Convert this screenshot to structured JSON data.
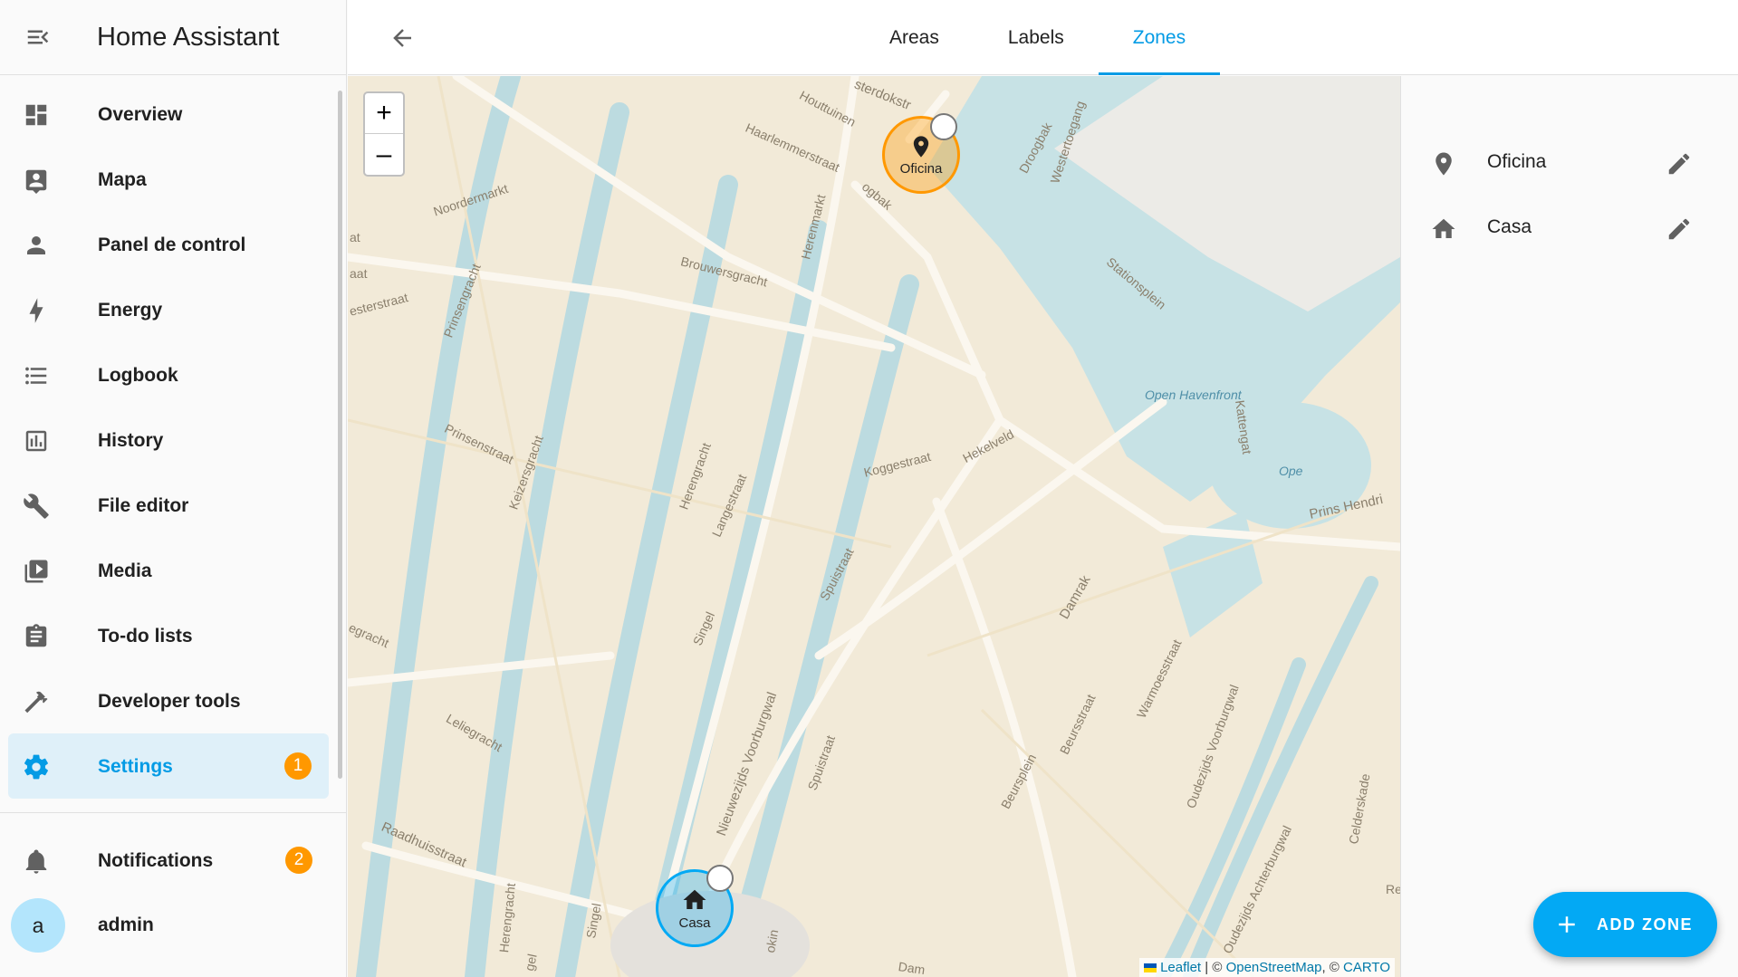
{
  "app": {
    "title": "Home Assistant"
  },
  "sidebar": {
    "items": [
      {
        "label": "Overview",
        "icon": "dashboard-icon"
      },
      {
        "label": "Mapa",
        "icon": "account-box-icon"
      },
      {
        "label": "Panel de control",
        "icon": "account-icon"
      },
      {
        "label": "Energy",
        "icon": "lightning-bolt-icon"
      },
      {
        "label": "Logbook",
        "icon": "format-list-icon"
      },
      {
        "label": "History",
        "icon": "chart-box-icon"
      },
      {
        "label": "File editor",
        "icon": "wrench-icon"
      },
      {
        "label": "Media",
        "icon": "play-box-multiple-icon"
      },
      {
        "label": "To-do lists",
        "icon": "clipboard-list-icon"
      },
      {
        "label": "Developer tools",
        "icon": "hammer-icon"
      },
      {
        "label": "Settings",
        "icon": "cog-icon",
        "badge": "1",
        "active": true
      }
    ],
    "notifications": {
      "label": "Notifications",
      "badge": "2"
    },
    "user": {
      "initial": "a",
      "name": "admin"
    }
  },
  "topbar": {
    "tabs": [
      {
        "label": "Areas"
      },
      {
        "label": "Labels"
      },
      {
        "label": "Zones",
        "active": true
      }
    ]
  },
  "map": {
    "zoom_in": "+",
    "zoom_out": "–",
    "street_labels": [
      "Houttuinen",
      "Haarlemmerstraat",
      "Noordermarkt",
      "Herenmarkt",
      "Brouwersgracht",
      "Droogbak",
      "Westertoegang",
      "Stationsplein",
      "Prinsengracht",
      "Prinsenstraat",
      "Keizersgracht",
      "Open Havenfront",
      "Kattengat",
      "Koggestraat",
      "Hekelveld",
      "Herengracht",
      "Langestraat",
      "Singel",
      "Spuistraat",
      "Nieuwezijds Voorburgwal",
      "Damrak",
      "Warmoesstraat",
      "Beursstraat",
      "Oudezijds Voorburgwal",
      "Beursplein",
      "Leliegracht",
      "Raadhuisstraat",
      "Prins Hendri",
      "Ope",
      "Celderskade",
      "Oudezijds Achterburgwal",
      "Dam",
      "esterstraat",
      "egracht",
      "sterdokstr",
      "ogbak",
      "aat",
      "at",
      "okin",
      "Re",
      "Spuistraat",
      "Singel",
      "Herengracht",
      "gel"
    ],
    "zones": [
      {
        "name": "Oficina",
        "icon": "map-marker-icon",
        "color": "#ff9800"
      },
      {
        "name": "Casa",
        "icon": "home-icon",
        "color": "#03a9f4"
      }
    ],
    "attribution": {
      "leaflet": "Leaflet",
      "sep1": " | © ",
      "osm": "OpenStreetMap",
      "sep2": ", © ",
      "carto": "CARTO"
    }
  },
  "zone_list": [
    {
      "name": "Oficina",
      "icon": "map-marker-icon"
    },
    {
      "name": "Casa",
      "icon": "home-icon"
    }
  ],
  "fab": {
    "label": "ADD ZONE"
  },
  "colors": {
    "accent": "#03a9f4",
    "badge": "#ff9800",
    "active_bg": "#dff0f9"
  }
}
